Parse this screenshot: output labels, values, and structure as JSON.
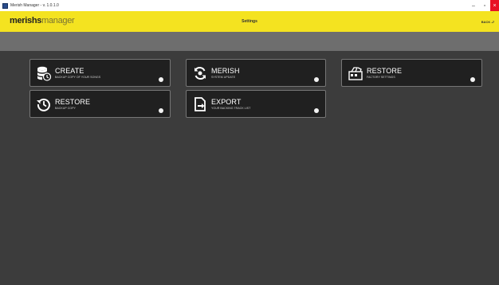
{
  "window": {
    "title": "Merish Manager - v. 1.0.1.0",
    "controls": {
      "minimize": "–",
      "maximize": "▫",
      "close": "×"
    }
  },
  "header": {
    "logo_bold": "merishs",
    "logo_thin": "manager",
    "page_title": "Settings",
    "back_label": "BACK ⮐"
  },
  "tiles": [
    {
      "title": "CREATE",
      "subtitle": "BACKUP COPY OF YOUR SONGS",
      "icon": "database-icon"
    },
    {
      "title": "MERISH",
      "subtitle": "SYSTEM UPDATE",
      "icon": "sync-icon"
    },
    {
      "title": "RESTORE",
      "subtitle": "FACTORY SETTINGS",
      "icon": "factory-reset-icon"
    },
    {
      "title": "RESTORE",
      "subtitle": "BACKUP COPY",
      "icon": "history-icon"
    },
    {
      "title": "EXPORT",
      "subtitle": "YOUR BACKING TRACK LIST",
      "icon": "export-icon"
    }
  ],
  "colors": {
    "header_yellow": "#f4e320",
    "background": "#3c3c3c",
    "tile_background": "#202020",
    "close_red": "#e81123"
  }
}
